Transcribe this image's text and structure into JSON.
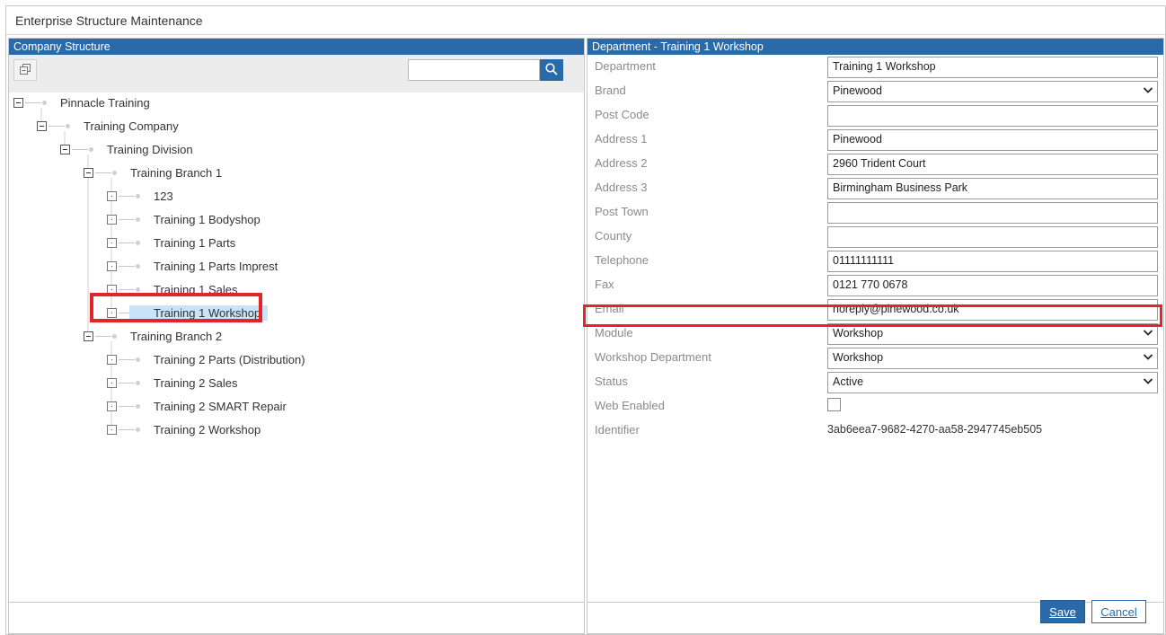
{
  "window": {
    "title": "Enterprise Structure Maintenance"
  },
  "left_pane": {
    "title": "Company Structure",
    "search": {
      "value": "",
      "placeholder": ""
    },
    "tree": [
      {
        "label": "Pinnacle Training",
        "level": 0,
        "expander": "minus"
      },
      {
        "label": "Training Company",
        "level": 1,
        "expander": "minus"
      },
      {
        "label": "Training Division",
        "level": 2,
        "expander": "minus"
      },
      {
        "label": "Training Branch 1",
        "level": 3,
        "expander": "minus"
      },
      {
        "label": "123",
        "level": 4,
        "expander": "dot"
      },
      {
        "label": "Training 1 Bodyshop",
        "level": 4,
        "expander": "dot"
      },
      {
        "label": "Training 1 Parts",
        "level": 4,
        "expander": "dot"
      },
      {
        "label": "Training 1 Parts Imprest",
        "level": 4,
        "expander": "dot"
      },
      {
        "label": "Training 1 Sales",
        "level": 4,
        "expander": "dot"
      },
      {
        "label": "Training 1 Workshop",
        "level": 4,
        "expander": "dot",
        "selected": true
      },
      {
        "label": "Training Branch 2",
        "level": 3,
        "expander": "minus"
      },
      {
        "label": "Training 2 Parts (Distribution)",
        "level": 4,
        "expander": "dot"
      },
      {
        "label": "Training 2 Sales",
        "level": 4,
        "expander": "dot"
      },
      {
        "label": "Training 2 SMART Repair",
        "level": 4,
        "expander": "dot"
      },
      {
        "label": "Training 2 Workshop",
        "level": 4,
        "expander": "dot"
      }
    ]
  },
  "right_pane": {
    "title": "Department - Training 1 Workshop",
    "fields": [
      {
        "label": "Department",
        "type": "text",
        "value": "Training 1 Workshop"
      },
      {
        "label": "Brand",
        "type": "select",
        "value": "Pinewood"
      },
      {
        "label": "Post Code",
        "type": "text",
        "value": ""
      },
      {
        "label": "Address 1",
        "type": "text",
        "value": "Pinewood"
      },
      {
        "label": "Address 2",
        "type": "text",
        "value": "2960 Trident Court"
      },
      {
        "label": "Address 3",
        "type": "text",
        "value": "Birmingham Business Park"
      },
      {
        "label": "Post Town",
        "type": "text",
        "value": ""
      },
      {
        "label": "County",
        "type": "text",
        "value": ""
      },
      {
        "label": "Telephone",
        "type": "text",
        "value": "01111111111"
      },
      {
        "label": "Fax",
        "type": "text",
        "value": "0121 770 0678"
      },
      {
        "label": "Email",
        "type": "text",
        "value": "noreply@pinewood.co.uk"
      },
      {
        "label": "Module",
        "type": "select",
        "value": "Workshop"
      },
      {
        "label": "Workshop Department",
        "type": "select",
        "value": "Workshop"
      },
      {
        "label": "Status",
        "type": "select",
        "value": "Active"
      },
      {
        "label": "Web Enabled",
        "type": "checkbox",
        "checked": false
      },
      {
        "label": "Identifier",
        "type": "readonly",
        "value": "3ab6eea7-9682-4270-aa58-2947745eb505"
      }
    ]
  },
  "footer": {
    "save_label": "Save",
    "cancel_label": "Cancel"
  },
  "colors": {
    "header": "#2b6aa8",
    "selection": "#c9e4f8",
    "highlight": "#e3242b"
  },
  "icons": {
    "collapse_all": "collapse-all-icon",
    "search": "search-icon",
    "dropdown": "chevron-down-icon"
  }
}
